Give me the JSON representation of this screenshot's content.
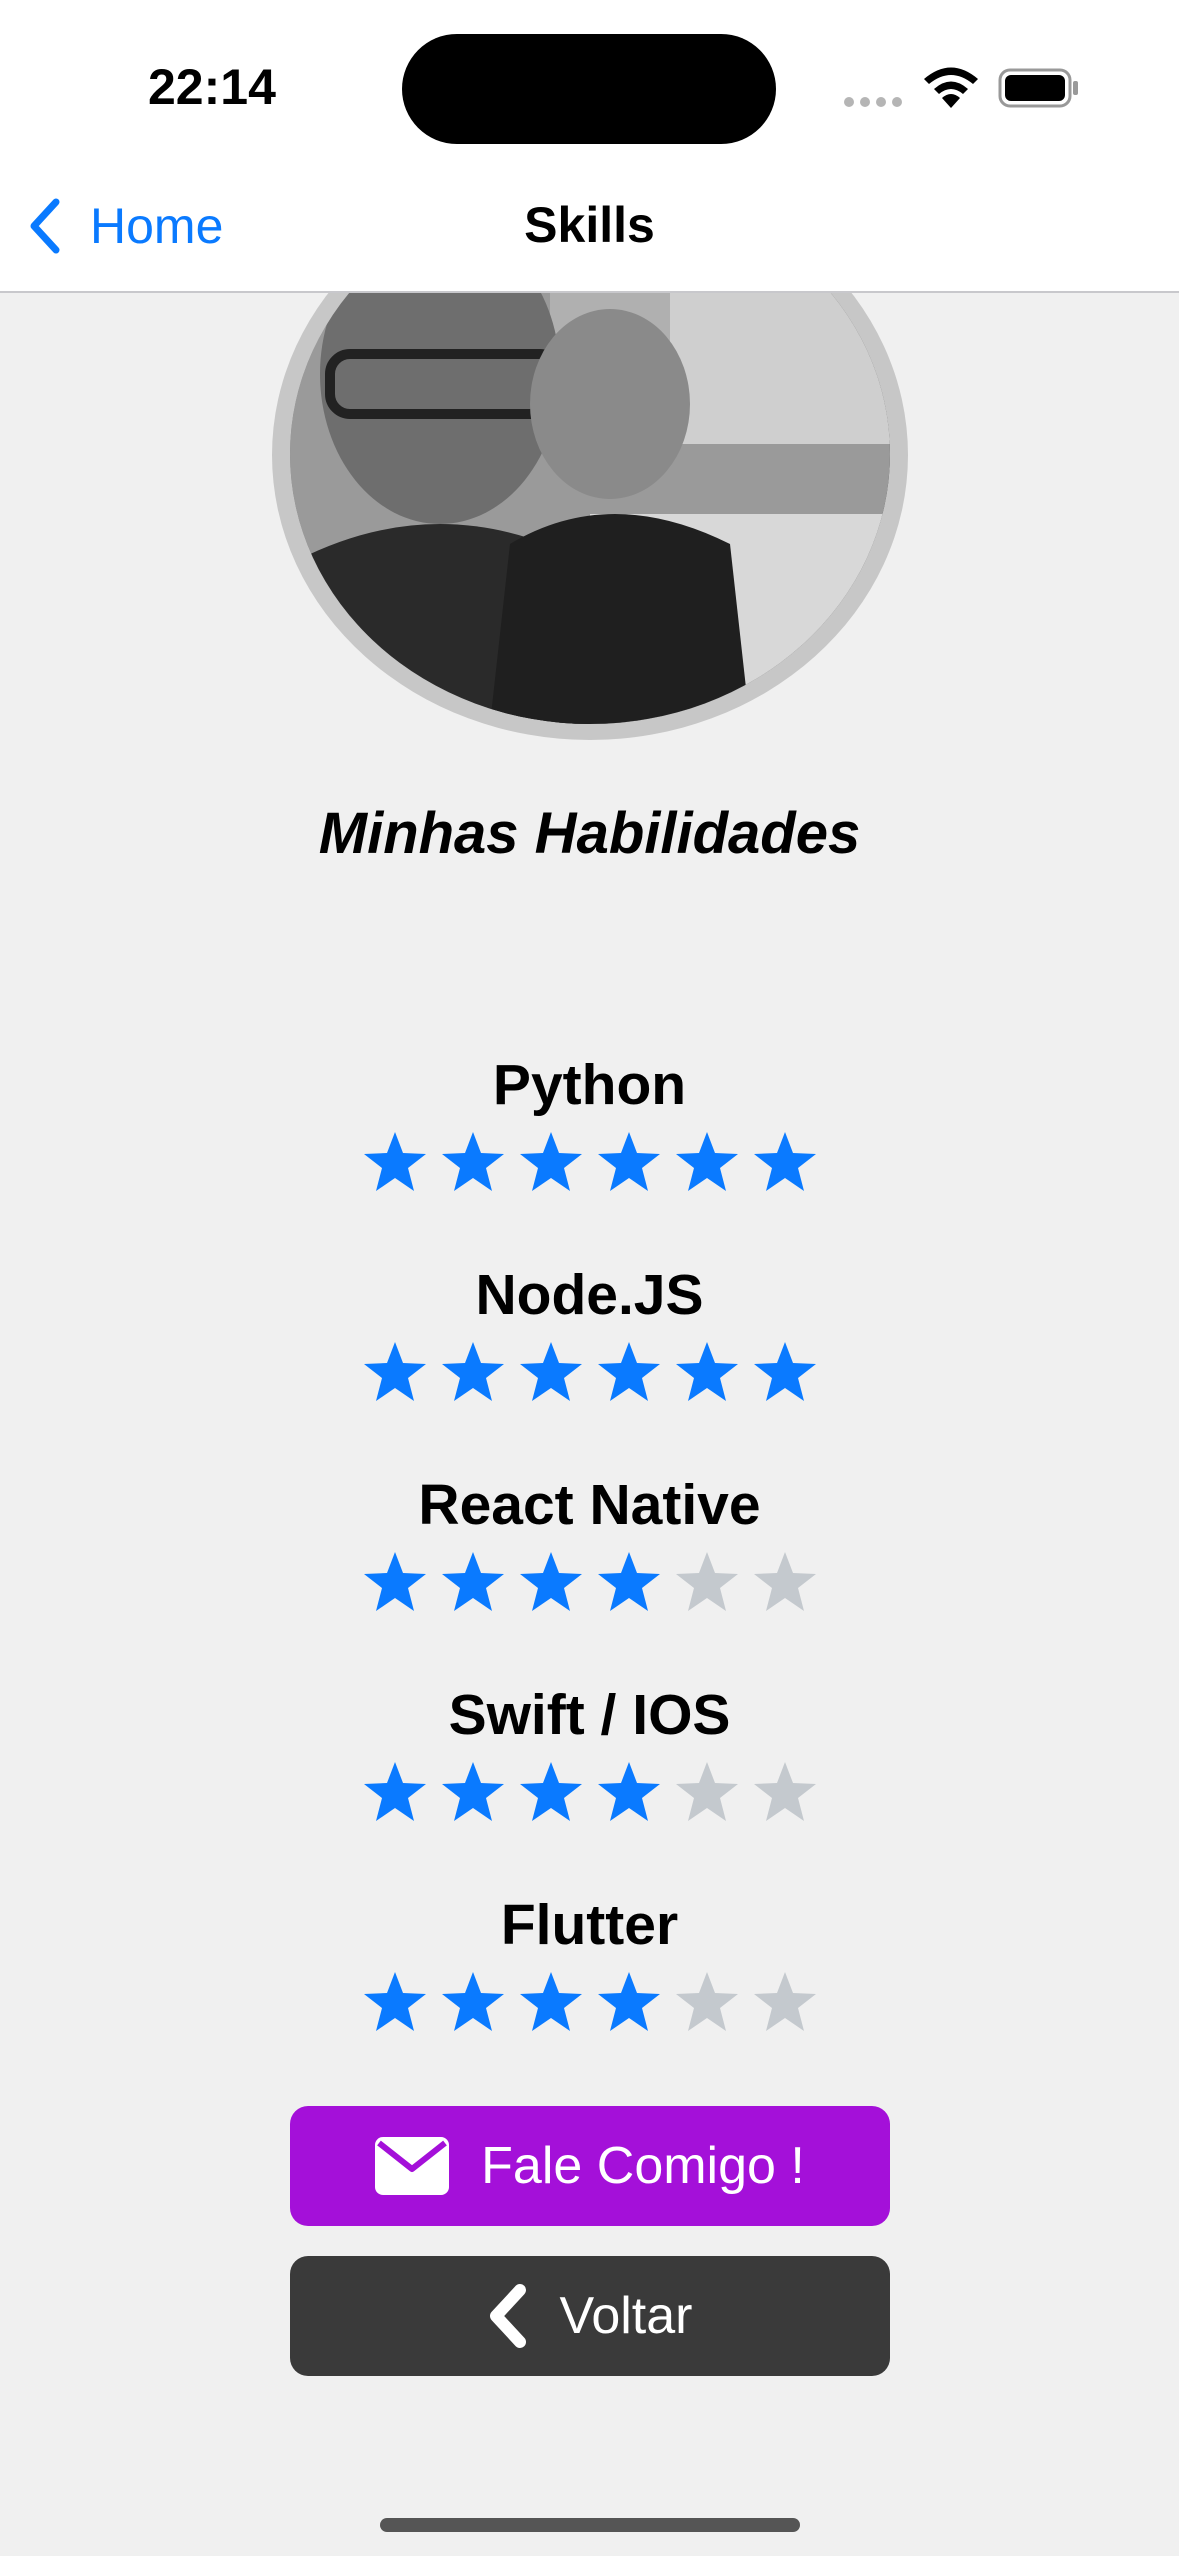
{
  "status_bar": {
    "time": "22:14"
  },
  "nav": {
    "back_label": "Home",
    "title": "Skills"
  },
  "profile": {
    "avatar_icon": "profile-photo"
  },
  "heading": "Minhas Habilidades",
  "skills": [
    {
      "name": "Python",
      "rating": 6,
      "max": 6
    },
    {
      "name": "Node.JS",
      "rating": 6,
      "max": 6
    },
    {
      "name": "React Native",
      "rating": 4,
      "max": 6
    },
    {
      "name": "Swift / IOS",
      "rating": 4,
      "max": 6
    },
    {
      "name": "Flutter",
      "rating": 4,
      "max": 6
    }
  ],
  "buttons": {
    "contact_label": "Fale Comigo !",
    "contact_icon": "envelope-icon",
    "back_label": "Voltar",
    "back_icon": "chevron-left-icon"
  },
  "colors": {
    "accent": "#0a7aff",
    "star_on": "#0a7aff",
    "star_off": "#c4c9ce",
    "contact_button": "#a410d9",
    "back_button": "#3a3a3a"
  }
}
